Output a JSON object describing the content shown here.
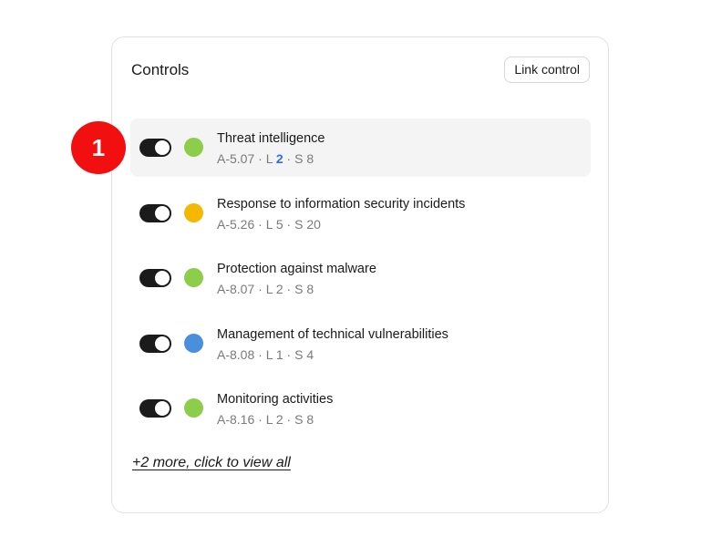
{
  "card": {
    "title": "Controls",
    "link_button": "Link control",
    "more_link": "+2 more, click to view all"
  },
  "controls": [
    {
      "name": "Threat intelligence",
      "code": "A-5.07",
      "level": "2",
      "score": "8",
      "status_color": "#8cce4a",
      "enabled": true,
      "level_highlight": true
    },
    {
      "name": "Response to information security incidents",
      "code": "A-5.26",
      "level": "5",
      "score": "20",
      "status_color": "#f5b800",
      "enabled": true,
      "level_highlight": false
    },
    {
      "name": "Protection against malware",
      "code": "A-8.07",
      "level": "2",
      "score": "8",
      "status_color": "#8cce4a",
      "enabled": true,
      "level_highlight": false
    },
    {
      "name": "Management of technical vulnerabilities",
      "code": "A-8.08",
      "level": "1",
      "score": "4",
      "status_color": "#4a8fdc",
      "enabled": true,
      "level_highlight": false
    },
    {
      "name": "Monitoring activities",
      "code": "A-8.16",
      "level": "2",
      "score": "8",
      "status_color": "#8cce4a",
      "enabled": true,
      "level_highlight": false
    }
  ],
  "meta_labels": {
    "separator": " · ",
    "level_prefix": "L ",
    "score_prefix": "S "
  },
  "marker": {
    "label": "1",
    "color": "#f20f0f"
  }
}
